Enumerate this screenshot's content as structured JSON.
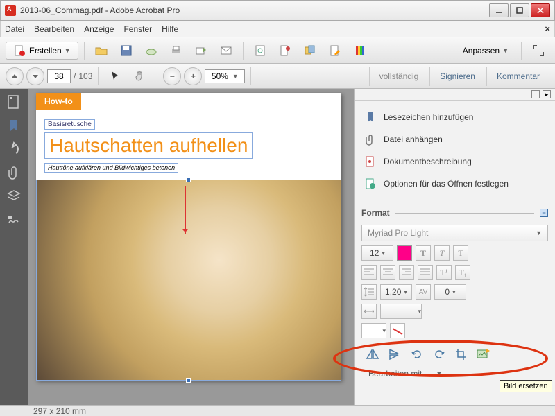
{
  "window": {
    "title": "2013-06_Commag.pdf - Adobe Acrobat Pro"
  },
  "menu": {
    "items": [
      "Datei",
      "Bearbeiten",
      "Anzeige",
      "Fenster",
      "Hilfe"
    ]
  },
  "toolbar1": {
    "create": "Erstellen",
    "customize": "Anpassen"
  },
  "toolbar2": {
    "page_current": "38",
    "page_total": "103",
    "zoom": "50%",
    "tab_full": "vollständig",
    "tab_sign": "Signieren",
    "tab_comment": "Kommentar"
  },
  "doc": {
    "tag": "How-to",
    "crumb": "Basisretusche",
    "headline": "Hautschatten aufhellen",
    "sub": "Hauttöne aufklären und Bildwichtiges betonen",
    "dims": "297 x 210 mm"
  },
  "panel": {
    "items": [
      "Lesezeichen hinzufügen",
      "Datei anhängen",
      "Dokumentbeschreibung",
      "Optionen für das Öffnen festlegen"
    ],
    "format": "Format",
    "font": "Myriad Pro Light",
    "size": "12",
    "line": "1,20",
    "av": "0",
    "edit_with": "Bearbeiten mit...",
    "tooltip": "Bild ersetzen"
  }
}
